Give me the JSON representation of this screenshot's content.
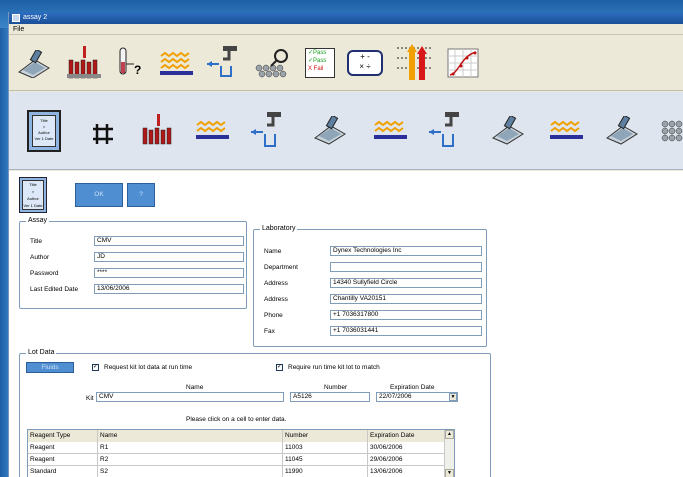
{
  "window": {
    "title": "assay 2"
  },
  "menu": {
    "file": "File"
  },
  "toolbar1": {
    "icons": [
      "plate-washer-icon",
      "sample-tubes-icon",
      "tube-query-icon",
      "plate-strip-icon",
      "dispense-icon",
      "plate-reader-icon",
      "pass-fail-icon",
      "calculation-icon",
      "threshold-icon",
      "curve-fit-icon"
    ],
    "pass_fail_lines": [
      "✓Pass",
      "✓Pass",
      "X Fail"
    ],
    "calc_symbols": [
      "+",
      "-",
      "×",
      "÷"
    ]
  },
  "toolbar2": {
    "assay_card": [
      "Title",
      "×",
      "Author",
      "Ver 1 Date"
    ],
    "icons": [
      "assay-card-icon",
      "grid-icon",
      "sample-tubes-icon",
      "plate-strip-icon",
      "dispense-icon",
      "plate-washer-icon",
      "plate-strip-icon",
      "dispense-icon",
      "plate-washer-icon",
      "plate-strip-icon",
      "plate-washer-icon",
      "plate-reader-icon"
    ]
  },
  "header": {
    "ok_label": "OK",
    "help_label": "?",
    "card": [
      "Title",
      "×",
      "Author",
      "Ver 1 Date"
    ]
  },
  "assay": {
    "legend": "Assay",
    "title_label": "Title",
    "title_value": "CMV",
    "author_label": "Author",
    "author_value": "JD",
    "password_label": "Password",
    "password_value": "****",
    "last_edited_label": "Last Edited Date",
    "last_edited_value": "13/06/2006"
  },
  "laboratory": {
    "legend": "Laboratory",
    "name_label": "Name",
    "name_value": "Dynex Technologies Inc",
    "department_label": "Department",
    "department_value": "",
    "address_label": "Address",
    "address1_value": "14340 Sullyfield Circle",
    "address2_value": "Chantilly VA20151",
    "phone_label": "Phone",
    "phone_value": "+1 7036317800",
    "fax_label": "Fax",
    "fax_value": "+1 7036031441"
  },
  "lot_data": {
    "legend": "Lot Data",
    "fluids_label": "Fluids",
    "request_kit_label": "Request kit lot data at run time",
    "require_kit_label": "Require run time kit lot to match",
    "kit_label": "Kit",
    "name_header": "Name",
    "number_header": "Number",
    "expiration_header": "Expiration Date",
    "kit_name": "CMV",
    "kit_number": "A5126",
    "kit_expiration": "22/07/2006",
    "instruction": "Please click on a cell to enter data."
  },
  "reagent_table": {
    "columns": [
      "Reagent Type",
      "Name",
      "Number",
      "Expiration Date"
    ],
    "rows": [
      [
        "Reagent",
        "R1",
        "11003",
        "30/06/2006"
      ],
      [
        "Reagent",
        "R2",
        "11045",
        "29/06/2006"
      ],
      [
        "Standard",
        "S2",
        "11990",
        "13/06/2006"
      ]
    ]
  },
  "colors": {
    "desktop": "#2a6cae",
    "window": "#ece9d8",
    "accent_button": "#4f8ed1"
  }
}
